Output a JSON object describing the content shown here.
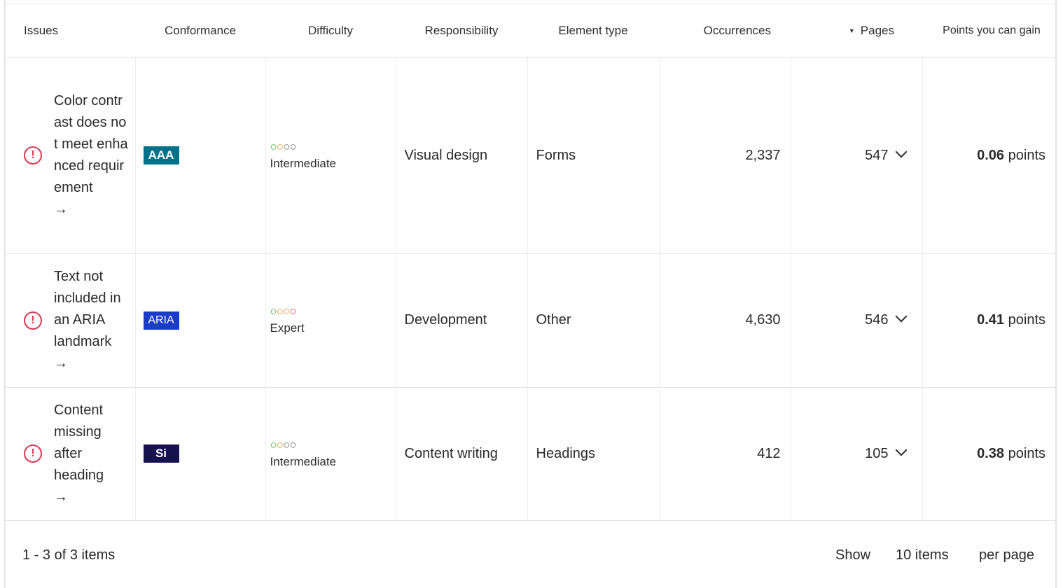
{
  "columns": {
    "issues": "Issues",
    "conformance": "Conformance",
    "difficulty": "Difficulty",
    "responsibility": "Responsibility",
    "element_type": "Element type",
    "occurrences": "Occurrences",
    "pages": "Pages",
    "points": "Points you can gain"
  },
  "rows": [
    {
      "issue": "Color contrast does not meet enhanced requirement",
      "arrow": "→",
      "conformance": "AAA",
      "difficulty": "Intermediate",
      "responsibility": "Visual design",
      "element_type": "Forms",
      "occurrences": "2,337",
      "pages": "547",
      "points_value": "0.06",
      "points_unit": "points"
    },
    {
      "issue": "Text not included in an ARIA landmark",
      "arrow": "→",
      "conformance": "ARIA",
      "difficulty": "Expert",
      "responsibility": "Development",
      "element_type": "Other",
      "occurrences": "4,630",
      "pages": "546",
      "points_value": "0.41",
      "points_unit": "points"
    },
    {
      "issue": "Content missing after heading",
      "arrow": "→",
      "conformance": "Si",
      "difficulty": "Intermediate",
      "responsibility": "Content writing",
      "element_type": "Headings",
      "occurrences": "412",
      "pages": "105",
      "points_value": "0.38",
      "points_unit": "points"
    }
  ],
  "footer": {
    "range": "1 - 3 of 3 items",
    "show": "Show",
    "per_page_value": "10 items",
    "per_page": "per page"
  },
  "colors": {
    "warning": "#d83a56",
    "badge_aaa": "#00738a",
    "badge_aria": "#1a3cc7",
    "badge_si": "#16124f"
  }
}
